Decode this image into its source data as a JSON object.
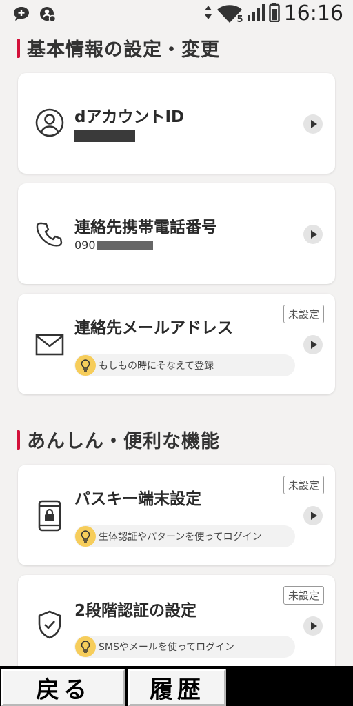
{
  "status_bar": {
    "time": "16:16",
    "network": "5",
    "icons": [
      "chat-bubble-icon",
      "account-sync-icon",
      "data-arrows-icon",
      "wifi-icon",
      "signal-icon",
      "battery-icon"
    ]
  },
  "sections": [
    {
      "title": "基本情報の設定・変更",
      "cards": [
        {
          "icon": "person-circle-icon",
          "title": "dアカウントID",
          "value_prefix": ""
        },
        {
          "icon": "phone-icon",
          "title": "連絡先携帯電話番号",
          "value_prefix": "090"
        },
        {
          "icon": "mail-icon",
          "title": "連絡先メールアドレス",
          "badge": "未設定",
          "hint": "もしもの時にそなえて登録"
        }
      ]
    },
    {
      "title": "あんしん・便利な機能",
      "cards": [
        {
          "icon": "smartphone-lock-icon",
          "title": "パスキー端末設定",
          "badge": "未設定",
          "hint": "生体認証やパターンを使ってログイン"
        },
        {
          "icon": "shield-check-icon",
          "title": "2段階認証の設定",
          "badge": "未設定",
          "hint": "SMSやメールを使ってログイン"
        }
      ]
    }
  ],
  "bottom_nav": {
    "back": "戻る",
    "history": "履歴"
  },
  "colors": {
    "accent": "#d3113a",
    "bulb": "#f6cd5b",
    "background": "#f3f2f1"
  }
}
